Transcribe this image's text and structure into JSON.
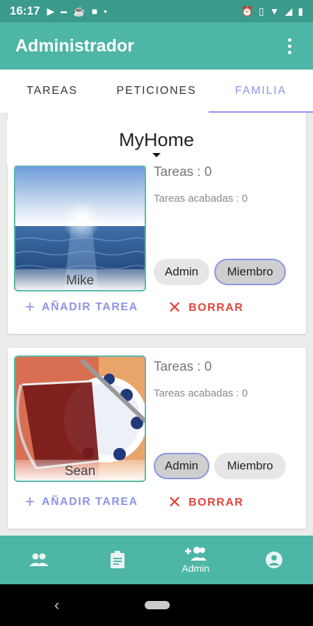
{
  "statusbar": {
    "time": "16:17",
    "left_icons": [
      "play-icon",
      "pse-icon",
      "cup-icon",
      "square-icon"
    ],
    "right_icons": [
      "alarm-icon",
      "vibrate-icon",
      "wifi-icon",
      "signal-icon",
      "battery-icon"
    ]
  },
  "appbar": {
    "title": "Administrador"
  },
  "tabs": [
    {
      "label": "TAREAS",
      "active": false
    },
    {
      "label": "PETICIONES",
      "active": false
    },
    {
      "label": "FAMILIA",
      "active": true
    }
  ],
  "family": {
    "home_name": "MyHome"
  },
  "members": [
    {
      "name": "Mike",
      "tareas": "Tareas : 0",
      "acabadas": "Tareas acabadas : 0",
      "admin_label": "Admin",
      "miembro_label": "Miembro",
      "selected_role": "Miembro",
      "add_label": "AÑADIR TAREA",
      "delete_label": "BORRAR"
    },
    {
      "name": "Sean",
      "tareas": "Tareas : 0",
      "acabadas": "Tareas acabadas : 0",
      "admin_label": "Admin",
      "miembro_label": "Miembro",
      "selected_role": "Admin",
      "add_label": "AÑADIR TAREA",
      "delete_label": "BORRAR"
    }
  ],
  "bottomnav": [
    {
      "icon": "group-icon",
      "label": ""
    },
    {
      "icon": "clipboard-icon",
      "label": ""
    },
    {
      "icon": "add-person-icon",
      "label": "Admin"
    },
    {
      "icon": "account-icon",
      "label": ""
    }
  ],
  "colors": {
    "statusbar": "#3a9a8b",
    "appbar": "#4db6a6",
    "accent": "#8c94e6",
    "danger": "#e0443b"
  }
}
